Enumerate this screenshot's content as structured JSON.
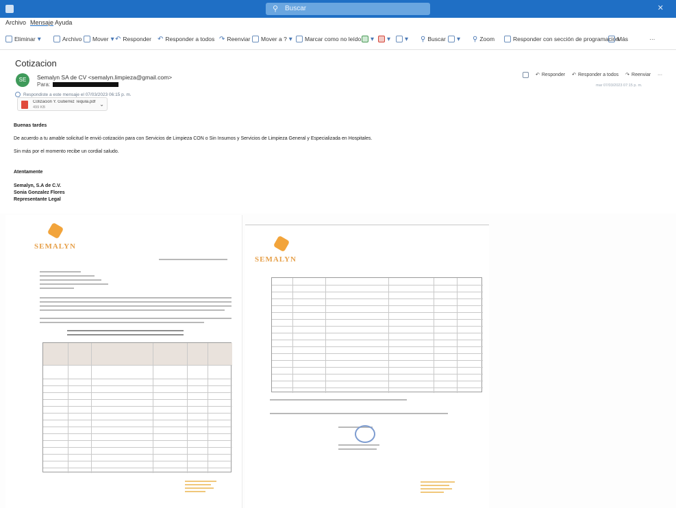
{
  "titlebar": {
    "title": "",
    "search_label": "Buscar"
  },
  "menu": {
    "tabs": [
      "Archivo",
      "Mensaje",
      "Ayuda"
    ]
  },
  "ribbon": {
    "items": [
      "Eliminar",
      "Archivo",
      "Mover",
      "Responder",
      "Responder a todos",
      "Reenviar",
      "Mover a ?",
      "Marcar como no leído",
      "Buscar",
      "Zoom",
      "Responder con sección de programación",
      "Más"
    ]
  },
  "message": {
    "subject": "Cotizacion",
    "avatar_initials": "SE",
    "sender": "Semalyn SA de CV <semalyn.limpieza@gmail.com>",
    "to_label": "Para:",
    "info_line": "Respondiste a este mensaje el 07/03/2023 06:15 p. m.",
    "attachment_name": "Cotizacion Y. Gutierrez Tequila.pdf",
    "attachment_size": "499 KB",
    "greeting": "Buenas tardes",
    "paragraph": "De acuerdo a tu amable solicitud le envió cotización para con Servicios de Limpieza CON o Sin Insumos y Servicios de Limpieza General y Especializada en Hospitales.",
    "closing_line": "Sin más por el momento recibe un cordial saludo.",
    "sign_off": "Atentamente",
    "sig_company": "Semalyn, S.A de C.V.",
    "sig_name": "Sonia Gonzalez Flores",
    "sig_title": "Representante Legal"
  },
  "actions": {
    "reply": "Responder",
    "reply_all": "Responder a todos",
    "forward": "Reenviar",
    "more": "···",
    "date": "mar 07/03/2023 07:15 p. m."
  },
  "scans": {
    "logo_text": "SEMALYN"
  }
}
